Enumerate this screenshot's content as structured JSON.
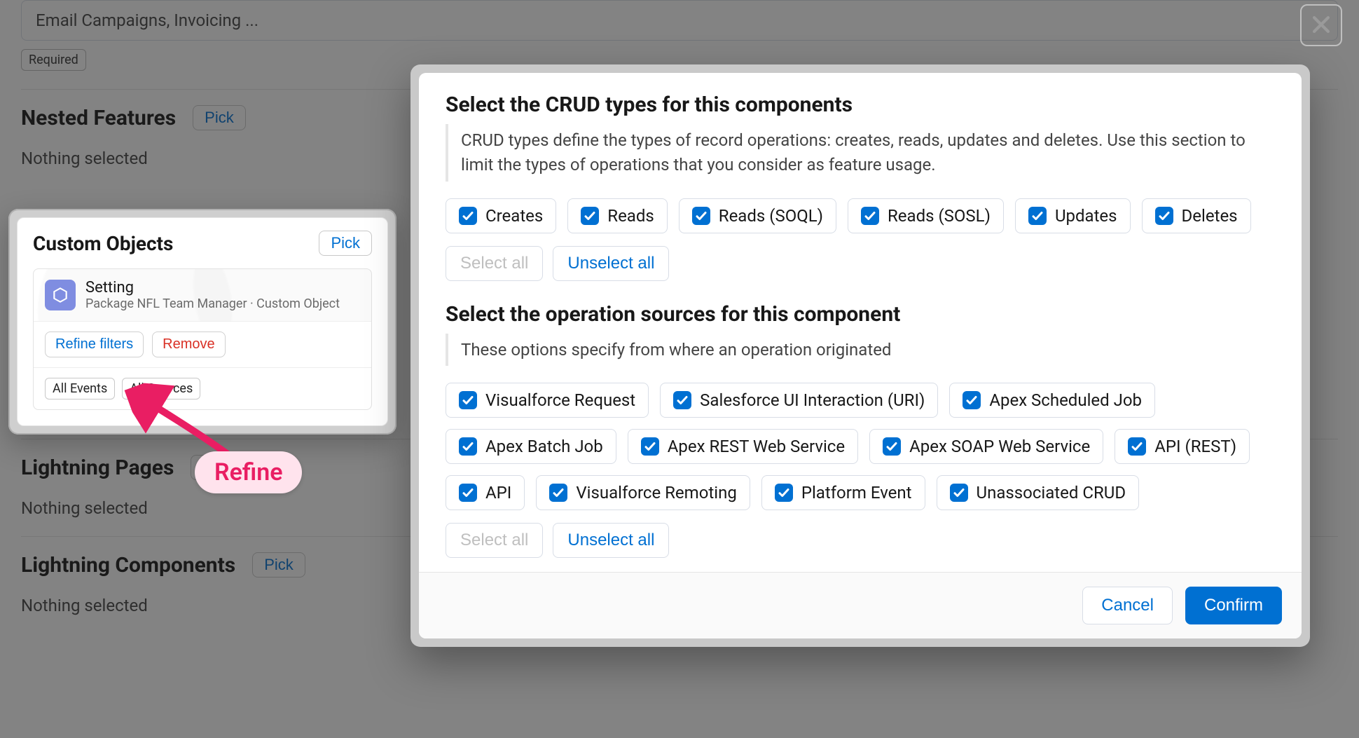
{
  "page": {
    "input_placeholder": "Email Campaigns, Invoicing ...",
    "required_chip": "Required",
    "sections": {
      "nested_features": {
        "title": "Nested Features",
        "pick": "Pick",
        "empty": "Nothing selected"
      },
      "lightning_pages": {
        "title": "Lightning Pages",
        "pick": "Pick",
        "empty": "Nothing selected"
      },
      "lightning_components": {
        "title": "Lightning Components",
        "pick": "Pick",
        "empty": "Nothing selected"
      }
    }
  },
  "custom_objects": {
    "title": "Custom Objects",
    "pick": "Pick",
    "item": {
      "name": "Setting",
      "subtitle": "Package NFL Team Manager · Custom Object",
      "refine": "Refine filters",
      "remove": "Remove",
      "chips": [
        "All Events",
        "All Sources"
      ]
    }
  },
  "refine_badge": "Refine",
  "modal": {
    "crud": {
      "title": "Select the CRUD types for this components",
      "desc": "CRUD types define the types of record operations: creates, reads, updates and deletes. Use this section to limit the types of operations that you consider as feature usage.",
      "options": [
        "Creates",
        "Reads",
        "Reads (SOQL)",
        "Reads (SOSL)",
        "Updates",
        "Deletes"
      ]
    },
    "sources": {
      "title": "Select the operation sources for this component",
      "desc": "These options specify from where an operation originated",
      "options": [
        "Visualforce Request",
        "Salesforce UI Interaction (URI)",
        "Apex Scheduled Job",
        "Apex Batch Job",
        "Apex REST Web Service",
        "Apex SOAP Web Service",
        "API (REST)",
        "API",
        "Visualforce Remoting",
        "Platform Event",
        "Unassociated CRUD"
      ]
    },
    "select_all": "Select all",
    "unselect_all": "Unselect all",
    "cancel": "Cancel",
    "confirm": "Confirm"
  }
}
